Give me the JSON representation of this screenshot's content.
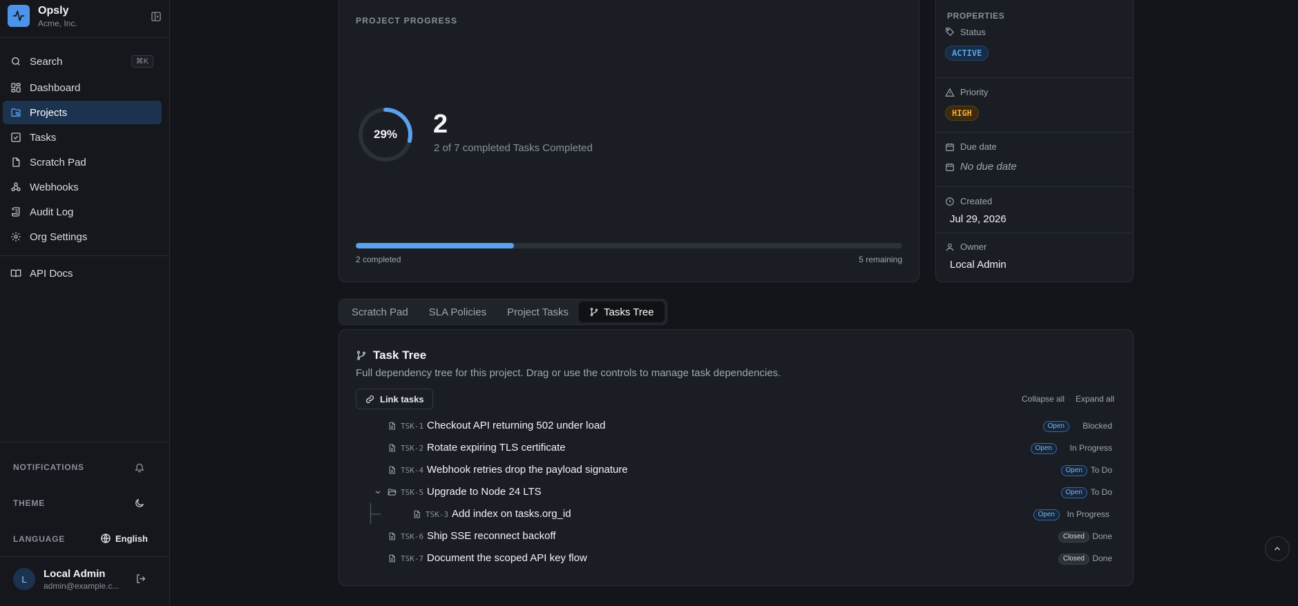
{
  "brand": {
    "name": "Opsly",
    "org": "Acme, Inc."
  },
  "nav": {
    "search_label": "Search",
    "search_shortcut": "⌘K",
    "items": [
      {
        "label": "Dashboard",
        "icon": "dashboard-icon"
      },
      {
        "label": "Projects",
        "icon": "folder-icon",
        "active": true
      },
      {
        "label": "Tasks",
        "icon": "check-square-icon"
      },
      {
        "label": "Scratch Pad",
        "icon": "file-icon"
      },
      {
        "label": "Webhooks",
        "icon": "webhook-icon"
      },
      {
        "label": "Audit Log",
        "icon": "scroll-icon"
      },
      {
        "label": "Org Settings",
        "icon": "gear-icon"
      }
    ],
    "api_docs": "API Docs"
  },
  "sidebar_footer": {
    "notifications_label": "NOTIFICATIONS",
    "theme_label": "THEME",
    "language_label": "LANGUAGE",
    "language_value": "English"
  },
  "user": {
    "initial": "L",
    "name": "Local Admin",
    "email": "admin@example.c..."
  },
  "progress": {
    "label": "PROJECT PROGRESS",
    "percent_text": "29%",
    "percent": 0.29,
    "completed_count": "2",
    "summary": "2 of 7 completed Tasks Completed",
    "completed_text": "2 completed",
    "remaining_text": "5 remaining"
  },
  "properties": {
    "title": "PROPERTIES",
    "status_label": "Status",
    "status_value": "ACTIVE",
    "priority_label": "Priority",
    "priority_value": "HIGH",
    "due_label": "Due date",
    "due_value": "No due date",
    "created_label": "Created",
    "created_value": "Jul 29, 2026",
    "owner_label": "Owner",
    "owner_value": "Local Admin"
  },
  "tabs": [
    {
      "label": "Scratch Pad"
    },
    {
      "label": "SLA Policies"
    },
    {
      "label": "Project Tasks"
    },
    {
      "label": "Tasks Tree",
      "active": true
    }
  ],
  "tree": {
    "title": "Task Tree",
    "description": "Full dependency tree for this project. Drag or use the controls to manage task dependencies.",
    "link_button": "Link tasks",
    "collapse_all": "Collapse all",
    "separator": "·",
    "expand_all": "Expand all",
    "rows": [
      {
        "id": "TSK-1",
        "title": "Checkout API returning 502 under load",
        "state": "Open",
        "status": "Blocked",
        "depth": 0
      },
      {
        "id": "TSK-2",
        "title": "Rotate expiring TLS certificate",
        "state": "Open",
        "status": "In Progress",
        "depth": 0
      },
      {
        "id": "TSK-4",
        "title": "Webhook retries drop the payload signature",
        "state": "Open",
        "status": "To Do",
        "depth": 0
      },
      {
        "id": "TSK-5",
        "title": "Upgrade to Node 24 LTS",
        "state": "Open",
        "status": "To Do",
        "depth": 0,
        "expanded": true
      },
      {
        "id": "TSK-3",
        "title": "Add index on tasks.org_id",
        "state": "Open",
        "status": "In Progress",
        "depth": 1
      },
      {
        "id": "TSK-6",
        "title": "Ship SSE reconnect backoff",
        "state": "Closed",
        "status": "Done",
        "depth": 0
      },
      {
        "id": "TSK-7",
        "title": "Document the scoped API key flow",
        "state": "Closed",
        "status": "Done",
        "depth": 0
      }
    ]
  },
  "colors": {
    "accent": "#5aa0ec",
    "active_nav": "#1c3350",
    "high": "#f0a732"
  }
}
